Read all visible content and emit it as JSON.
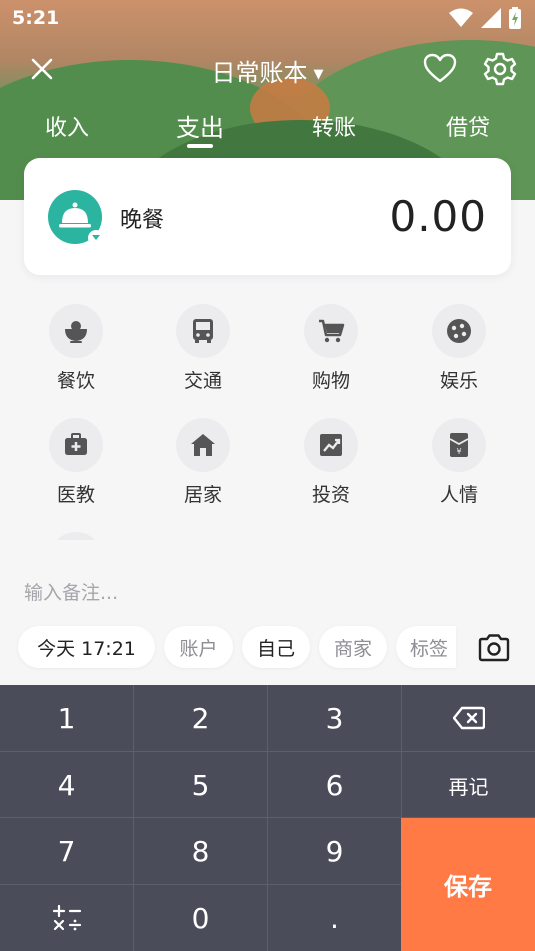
{
  "status_bar": {
    "time": "5:21"
  },
  "header": {
    "title": "日常账本",
    "tabs": [
      {
        "label": "收入",
        "active": false
      },
      {
        "label": "支出",
        "active": true
      },
      {
        "label": "转账",
        "active": false
      },
      {
        "label": "借贷",
        "active": false
      }
    ]
  },
  "entry": {
    "category": "晚餐",
    "category_icon": "service-bell-icon",
    "category_color": "#2bb5a0",
    "amount": "0.00"
  },
  "categories": [
    {
      "label": "餐饮",
      "icon": "rice-bowl-icon"
    },
    {
      "label": "交通",
      "icon": "bus-icon"
    },
    {
      "label": "购物",
      "icon": "cart-icon"
    },
    {
      "label": "娱乐",
      "icon": "gamepad-icon"
    },
    {
      "label": "医教",
      "icon": "medical-kit-icon"
    },
    {
      "label": "居家",
      "icon": "home-icon"
    },
    {
      "label": "投资",
      "icon": "trend-chart-icon"
    },
    {
      "label": "人情",
      "icon": "red-envelope-icon"
    }
  ],
  "note": {
    "placeholder": "输入备注..."
  },
  "chips": {
    "datetime": "今天 17:21",
    "account": "账户",
    "member": "自己",
    "merchant": "商家",
    "tag": "标签"
  },
  "keypad": {
    "keys": [
      "1",
      "2",
      "3",
      "4",
      "5",
      "6",
      "7",
      "8",
      "9",
      "0",
      "."
    ],
    "again": "再记",
    "save": "保存",
    "operators": "+-×÷",
    "save_color": "#ff7a45"
  }
}
